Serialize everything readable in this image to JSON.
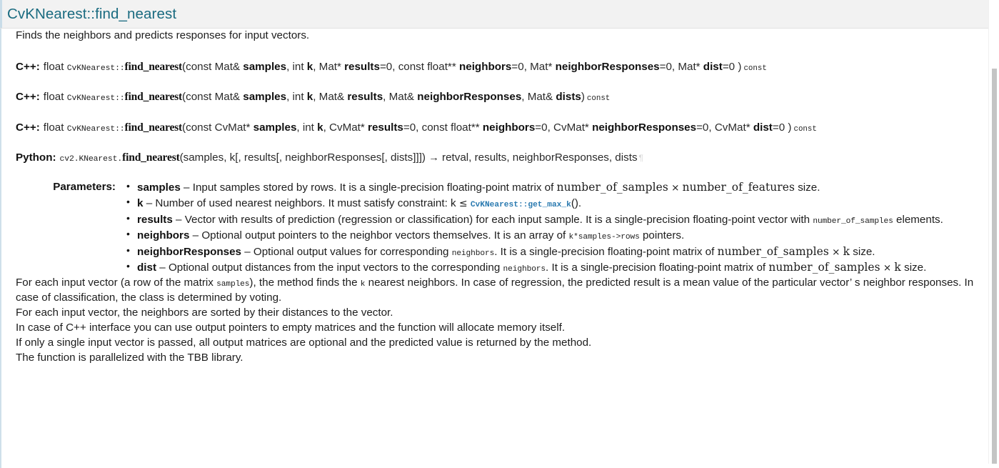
{
  "header": {
    "title": "CvKNearest::find_nearest",
    "accent_color": "#1a6b80",
    "background": "#f2f2f2"
  },
  "intro": "Finds the neighbors and predicts responses for input vectors.",
  "signatures": [
    {
      "lang": "C++:",
      "return_type": "float",
      "scope": "CvKNearest::",
      "name": "find_nearest",
      "open_paren": "(",
      "args_html": "const Mat& samples, int k, Mat* results=0, const float** neighbors=0, Mat* neighborResponses=0, Mat* dist=0",
      "close_paren": ")",
      "qualifier": "const"
    },
    {
      "lang": "C++:",
      "return_type": "float",
      "scope": "CvKNearest::",
      "name": "find_nearest",
      "open_paren": "(",
      "args_html": "const Mat& samples, int k, Mat& results, Mat& neighborResponses, Mat& dists",
      "close_paren": ")",
      "qualifier": "const"
    },
    {
      "lang": "C++:",
      "return_type": "float",
      "scope": "CvKNearest::",
      "name": "find_nearest",
      "open_paren": "(",
      "args_html": "const CvMat* samples, int k, CvMat* results=0, const float** neighbors=0, CvMat* neighborResponses=0, CvMat* dist=0",
      "close_paren": ")",
      "qualifier": "const"
    }
  ],
  "python_signature": {
    "lang": "Python:",
    "module": "cv2.KNearest.",
    "name": "find_nearest",
    "args": "(samples, k[, results[, neighborResponses[, dists]]])",
    "arrow": "→",
    "returns": "retval, results, neighborResponses, dists",
    "pilcrow": "¶"
  },
  "parameters": {
    "label": "Parameters:",
    "items": [
      {
        "name": "samples",
        "dash": "–",
        "text_1": "Input samples stored by rows. It is a single-precision floating-point matrix of",
        "math_1": "number_of_samples",
        "times": "×",
        "math_2": "number_of_features",
        "text_2": "size."
      },
      {
        "name": "k",
        "dash": "–",
        "text_1": "Number of used nearest neighbors. It must satisfy constraint: k",
        "le": "≤",
        "link": "CvKNearest::get_max_k",
        "text_2": "()."
      },
      {
        "name": "results",
        "dash": "–",
        "text_1": "Vector with results of prediction (regression or classification) for each input sample. It is a single-precision floating-point vector with",
        "code_1": "number_of_samples",
        "text_2": "elements."
      },
      {
        "name": "neighbors",
        "dash": "–",
        "text_1": "Optional output pointers to the neighbor vectors themselves. It is an array of",
        "code_1": "k*samples->rows",
        "text_2": "pointers."
      },
      {
        "name": "neighborResponses",
        "dash": "–",
        "text_1": "Optional output values for corresponding",
        "code_1": "neighbors",
        "text_2": ". It is a single-precision floating-point matrix of",
        "math_1": "number_of_samples",
        "times": "×",
        "math_2": "k",
        "text_3": "size."
      },
      {
        "name": "dist",
        "dash": "–",
        "text_1": "Optional output distances from the input vectors to the corresponding",
        "code_1": "neighbors",
        "text_2": ". It is a single-precision floating-point matrix of",
        "math_1": "number_of_samples",
        "times": "×",
        "math_2": "k",
        "text_3": "size."
      }
    ]
  },
  "body_paragraphs": [
    {
      "part_1": "For each input vector (a row of the matrix",
      "code": "samples",
      "part_2": "), the method finds the",
      "code_2": "k",
      "part_3": "nearest neighbors. In case of regression, the predicted result is a mean value of the particular vector’ s neighbor responses. In case of classification, the class is determined by voting."
    },
    {
      "text": "For each input vector, the neighbors are sorted by their distances to the vector."
    },
    {
      "text": "In case of C++ interface you can use output pointers to empty matrices and the function will allocate memory itself."
    },
    {
      "text": "If only a single input vector is passed, all output matrices are optional and the predicted value is returned by the method."
    },
    {
      "text": "The function is parallelized with the TBB library."
    }
  ],
  "scrollbar": {
    "orientation": "vertical",
    "thumb_color": "#c4c4c4"
  }
}
